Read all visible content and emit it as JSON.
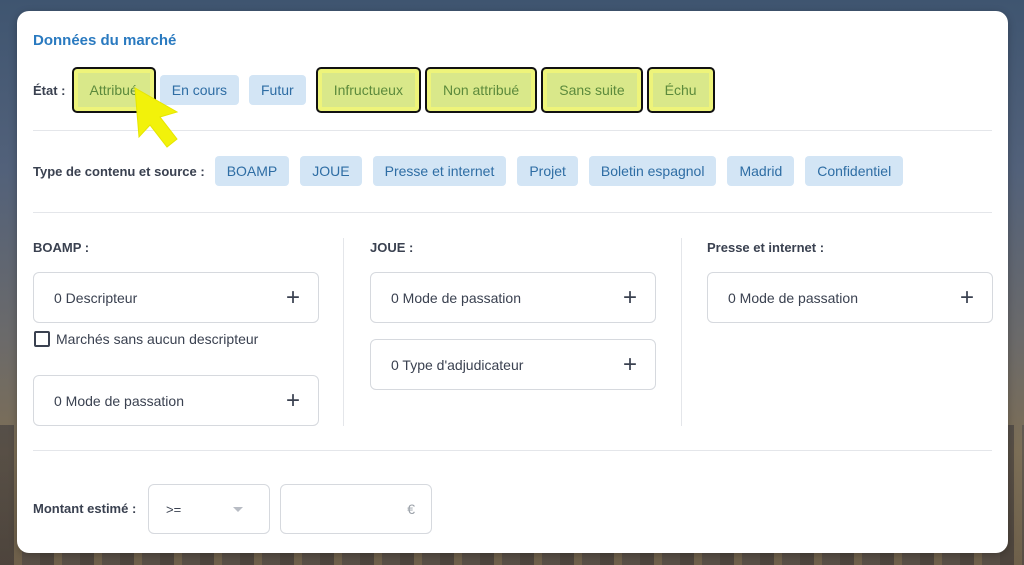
{
  "panel": {
    "title": "Données du marché"
  },
  "etat": {
    "label": "État :",
    "chips": [
      {
        "label": "Attribué",
        "highlighted": true
      },
      {
        "label": "En cours",
        "highlighted": false
      },
      {
        "label": "Futur",
        "highlighted": false
      },
      {
        "label": "Infructueux",
        "highlighted": true
      },
      {
        "label": "Non attribué",
        "highlighted": true
      },
      {
        "label": "Sans suite",
        "highlighted": true
      },
      {
        "label": "Échu",
        "highlighted": true
      }
    ]
  },
  "source": {
    "label": "Type de contenu et source :",
    "chips": [
      "BOAMP",
      "JOUE",
      "Presse et internet",
      "Projet",
      "Boletin espagnol",
      "Madrid",
      "Confidentiel"
    ]
  },
  "boamp": {
    "label": "BOAMP :",
    "descripteur": "0 Descripteur",
    "checkbox_label": "Marchés sans aucun descripteur",
    "mode_passation": "0 Mode de passation"
  },
  "joue": {
    "label": "JOUE :",
    "mode_passation": "0 Mode de passation",
    "type_adjudicateur": "0 Type d'adjudicateur"
  },
  "presse": {
    "label": "Presse et internet :",
    "mode_passation": "0 Mode de passation"
  },
  "montant": {
    "label": "Montant estimé :",
    "operator": ">=",
    "currency": "€"
  },
  "icons": {
    "plus": "+",
    "cursor": "pointer-arrow-icon"
  },
  "colors": {
    "accent": "#2a7ac0",
    "chip_bg": "#d3e5f5",
    "highlight_bg": "#d9e88a",
    "highlight_cursor": "#f2f20a"
  }
}
